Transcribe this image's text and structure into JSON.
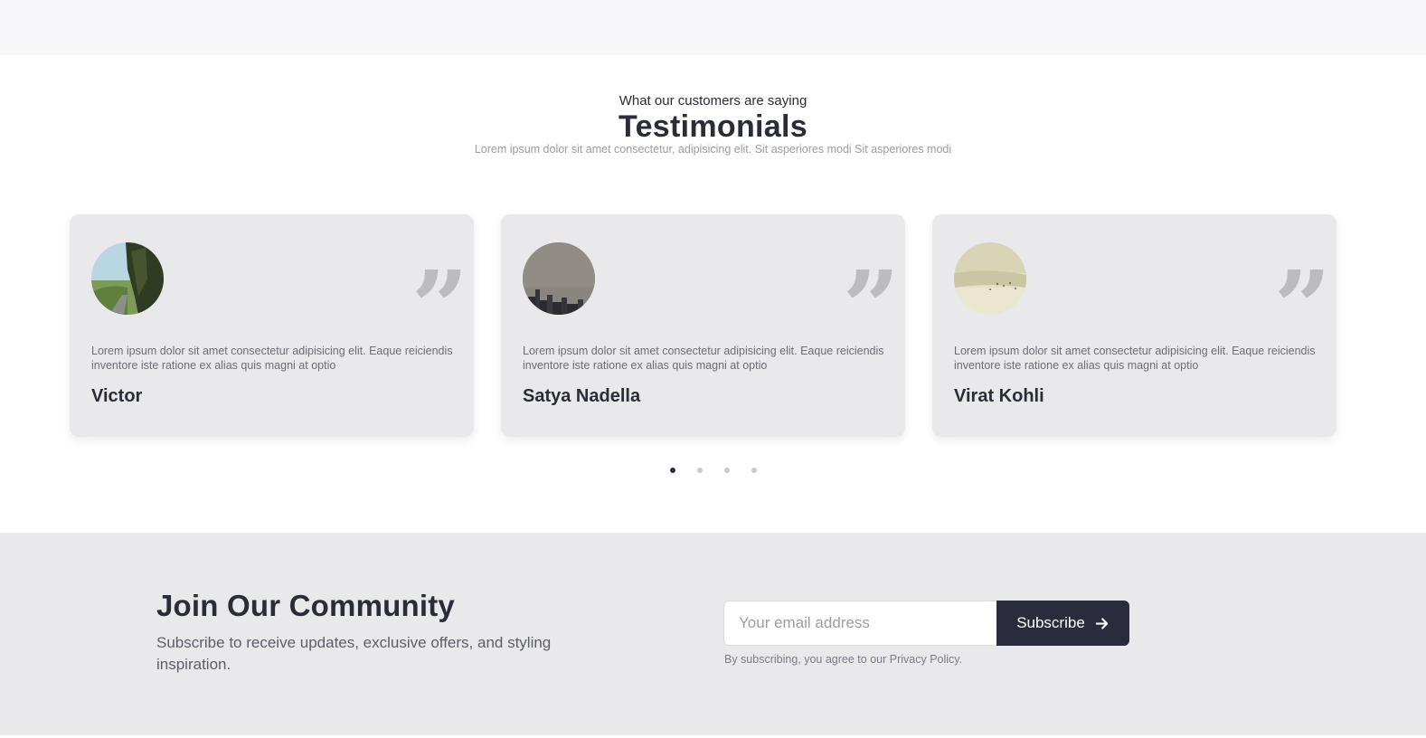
{
  "testimonials": {
    "kicker": "What our customers are saying",
    "title": "Testimonials",
    "subtitle": "Lorem ipsum dolor sit amet consectetur, adipisicing elit. Sit asperiores modi Sit asperiores modi",
    "quote_mark": "”",
    "cards": [
      {
        "text": "Lorem ipsum dolor sit amet consectetur adipisicing elit. Eaque reiciendis inventore iste ratione ex alias quis magni at optio",
        "author": "Victor",
        "avatar": "forest-road-photo"
      },
      {
        "text": "Lorem ipsum dolor sit amet consectetur adipisicing elit. Eaque reiciendis inventore iste ratione ex alias quis magni at optio",
        "author": "Satya Nadella",
        "avatar": "city-skyline-photo"
      },
      {
        "text": "Lorem ipsum dolor sit amet consectetur adipisicing elit. Eaque reiciendis inventore iste ratione ex alias quis magni at optio",
        "author": "Virat Kohli",
        "avatar": "beach-photo"
      }
    ],
    "pagination": {
      "count": 4,
      "active": 1
    }
  },
  "community": {
    "title": "Join Our Community",
    "description": "Subscribe to receive updates, exclusive offers, and styling inspiration.",
    "email_placeholder": "Your email address",
    "subscribe_label": "Subscribe",
    "subscribe_icon": "arrow-right-icon",
    "legal": "By subscribing, you agree to our Privacy Policy."
  },
  "colors": {
    "primary": "#2a2c3d",
    "card_bg": "#e9e9eb",
    "page_top": "#f7f7f9"
  }
}
